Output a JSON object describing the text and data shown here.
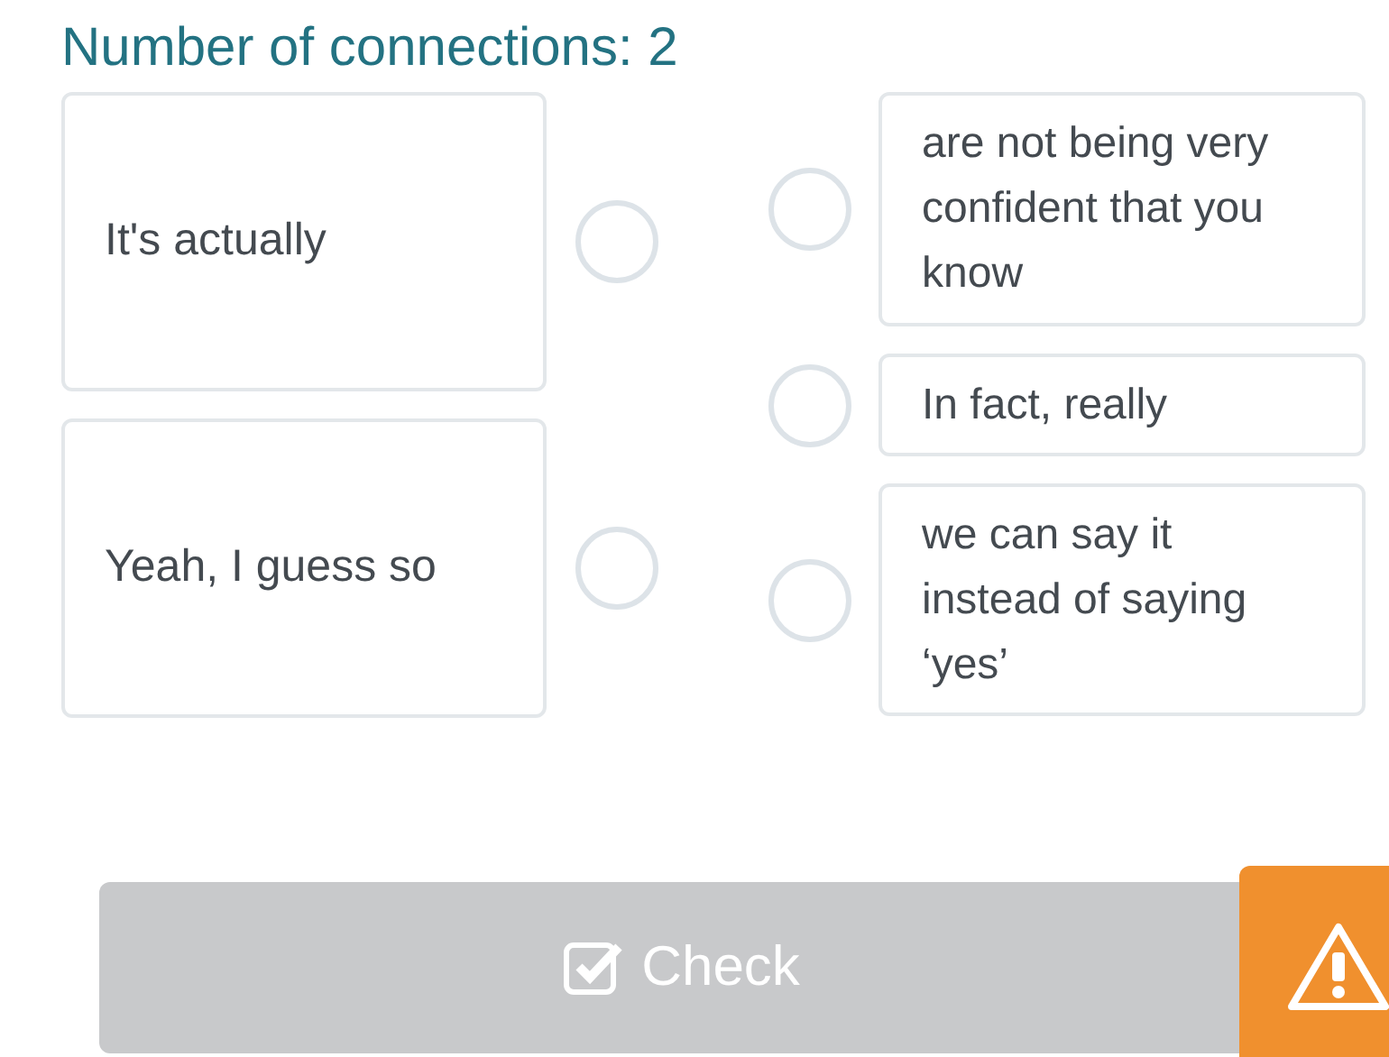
{
  "heading": "Number of connections: 2",
  "left_items": [
    {
      "text": "It's actually",
      "selected": false
    },
    {
      "text": "Yeah, I guess so",
      "selected": false
    }
  ],
  "right_items": [
    {
      "text": "are not being very confident that you know",
      "selected": false
    },
    {
      "text": "In fact, really",
      "selected": false
    },
    {
      "text": "we can say it instead of saying ‘yes’",
      "selected": false
    }
  ],
  "check_button": {
    "label": "Check",
    "disabled": true
  }
}
